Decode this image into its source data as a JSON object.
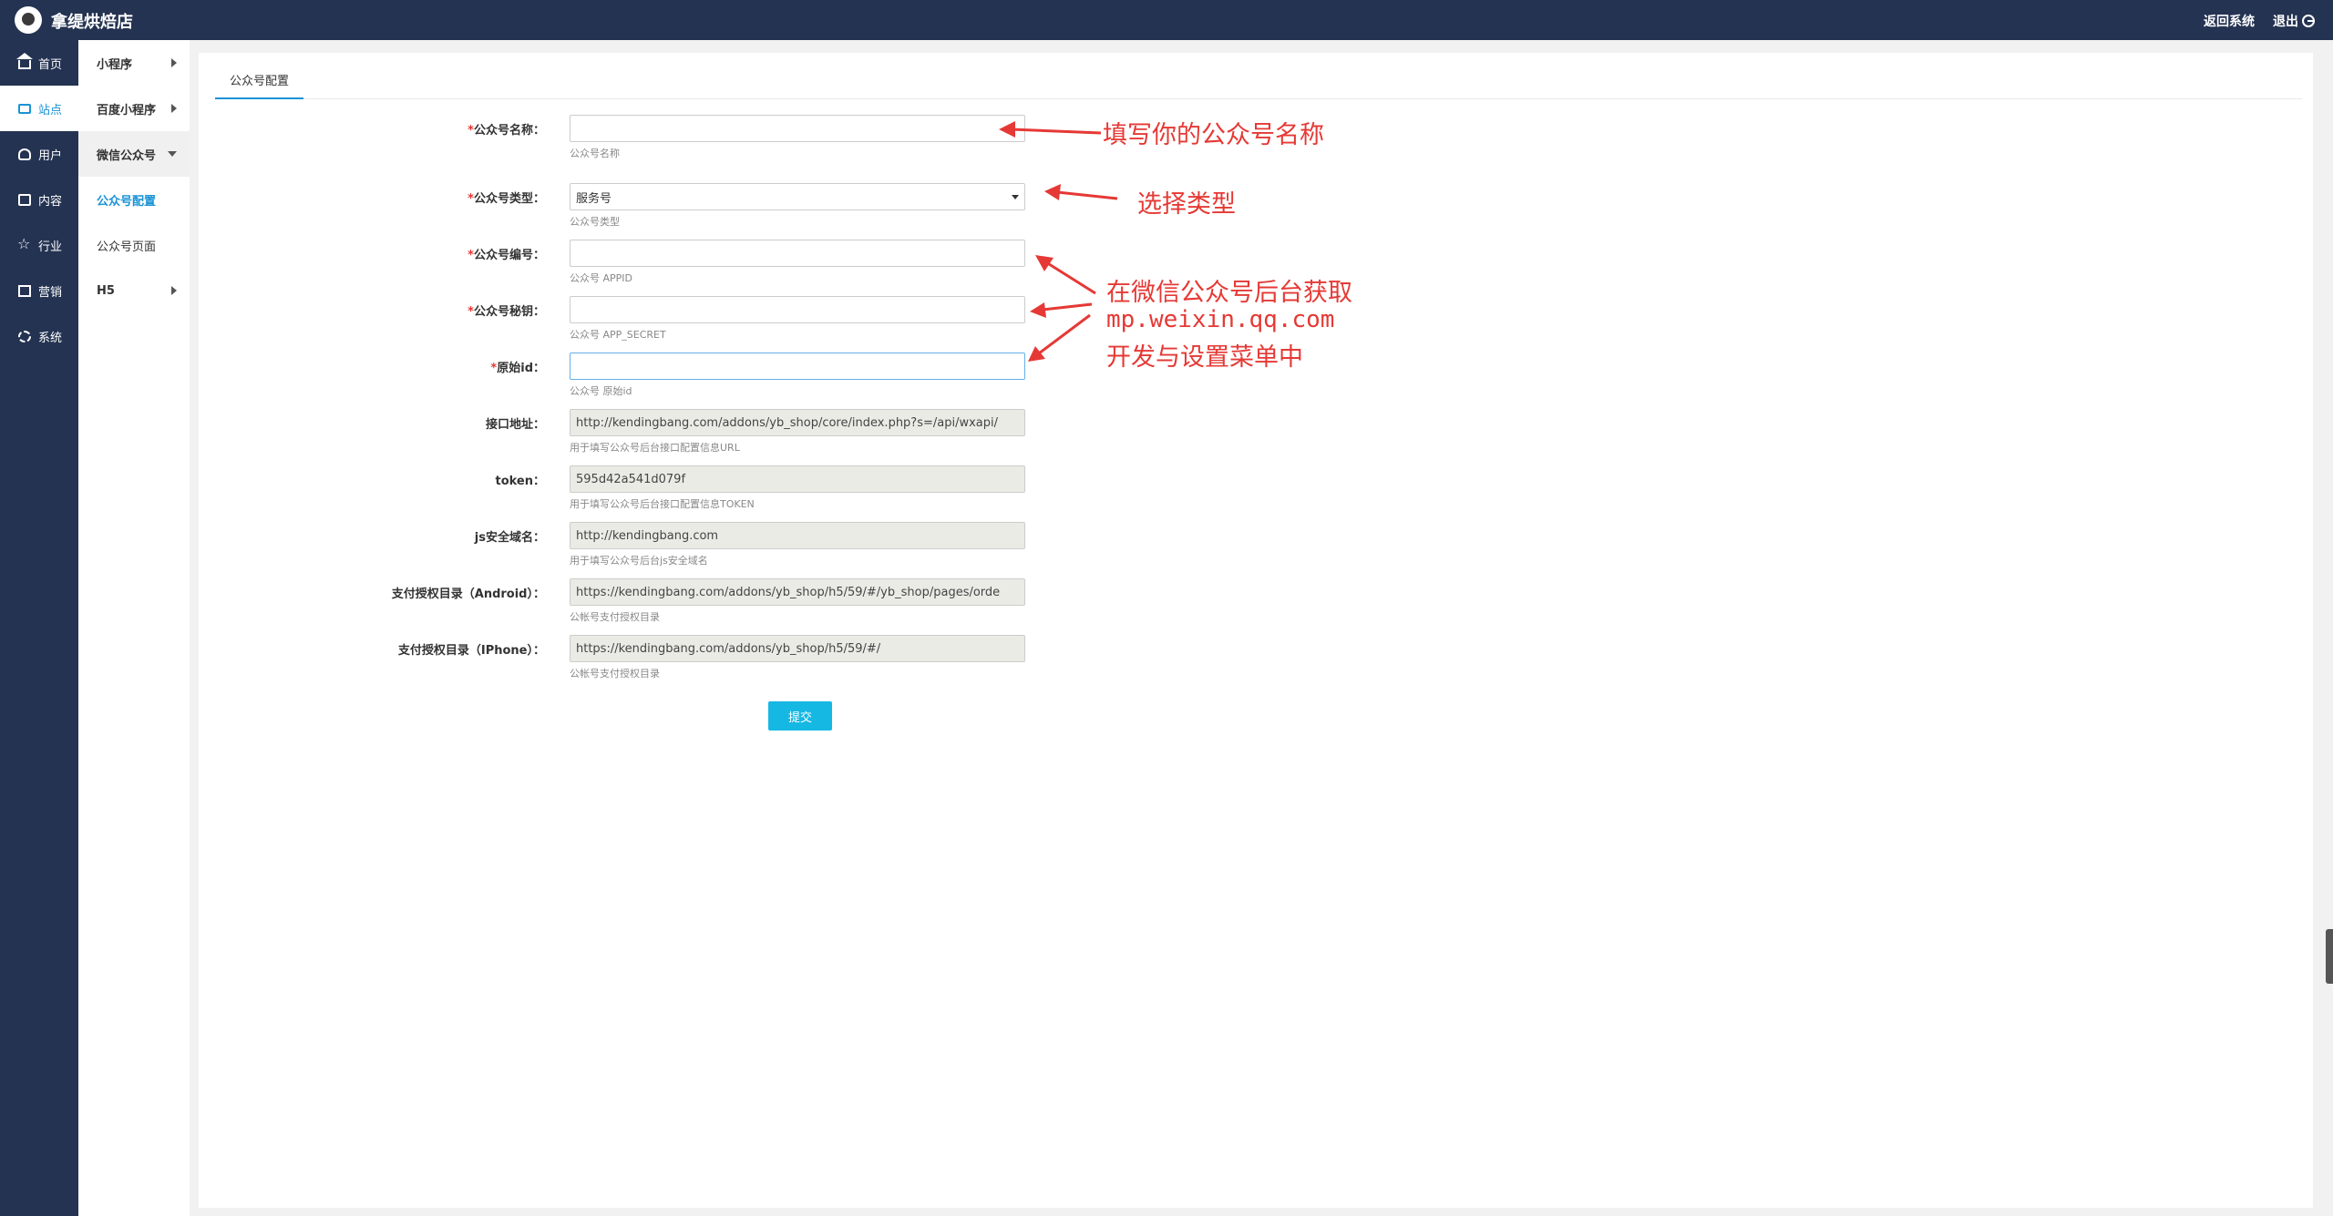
{
  "header": {
    "brand": "拿缇烘焙店",
    "back_label": "返回系统",
    "logout_label": "退出"
  },
  "sidebar": {
    "items": [
      {
        "label": "首页",
        "icon": "home-icon"
      },
      {
        "label": "站点",
        "icon": "monitor-icon",
        "active": true
      },
      {
        "label": "用户",
        "icon": "user-icon"
      },
      {
        "label": "内容",
        "icon": "inbox-icon"
      },
      {
        "label": "行业",
        "icon": "star-icon"
      },
      {
        "label": "营销",
        "icon": "chart-icon"
      },
      {
        "label": "系统",
        "icon": "gear-icon"
      }
    ]
  },
  "subnav": {
    "items": [
      {
        "label": "小程序"
      },
      {
        "label": "百度小程序"
      },
      {
        "label": "微信公众号"
      },
      {
        "label": "公众号配置"
      },
      {
        "label": "公众号页面"
      },
      {
        "label": "H5"
      }
    ]
  },
  "tabs": [
    {
      "label": "公众号配置"
    }
  ],
  "form": {
    "fields": [
      {
        "label": "公众号名称：",
        "required": true,
        "value": "",
        "help": "公众号名称"
      },
      {
        "label": "公众号类型：",
        "required": true,
        "value": "服务号",
        "help": "公众号类型"
      },
      {
        "label": "公众号编号：",
        "required": true,
        "value": "",
        "help": "公众号 APPID"
      },
      {
        "label": "公众号秘钥：",
        "required": true,
        "value": "",
        "help": "公众号 APP_SECRET"
      },
      {
        "label": "原始id：",
        "required": true,
        "value": "",
        "help": "公众号 原始id"
      },
      {
        "label": "接口地址：",
        "required": false,
        "value": "http://kendingbang.com/addons/yb_shop/core/index.php?s=/api/wxapi/",
        "help": "用于填写公众号后台接口配置信息URL"
      },
      {
        "label": "token：",
        "required": false,
        "value": "595d42a541d079f",
        "help": "用于填写公众号后台接口配置信息TOKEN"
      },
      {
        "label": "js安全域名：",
        "required": false,
        "value": "http://kendingbang.com",
        "help": "用于填写公众号后台js安全域名"
      },
      {
        "label": "支付授权目录（Android）：",
        "required": false,
        "value": "https://kendingbang.com/addons/yb_shop/h5/59/#/yb_shop/pages/orde",
        "help": "公帐号支付授权目录"
      },
      {
        "label": "支付授权目录（IPhone）：",
        "required": false,
        "value": "https://kendingbang.com/addons/yb_shop/h5/59/#/",
        "help": "公帐号支付授权目录"
      }
    ],
    "submit_label": "提交"
  },
  "annotations": {
    "name_hint": "填写你的公众号名称",
    "type_hint": "选择类型",
    "source_line1": "在微信公众号后台获取",
    "source_line2": "mp.weixin.qq.com",
    "source_line3": "开发与设置菜单中"
  },
  "colors": {
    "nav_bg": "#243352",
    "accent": "#1a93d6",
    "submit": "#15b8e3",
    "annotation": "#e53935"
  }
}
